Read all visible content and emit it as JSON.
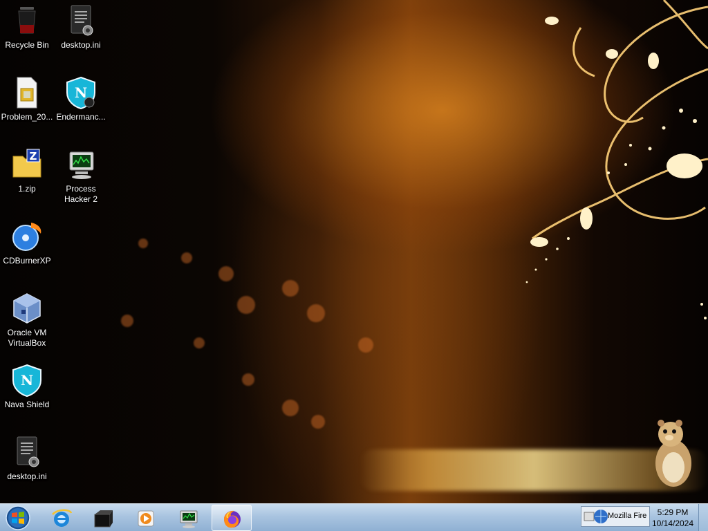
{
  "desktop": {
    "icons": [
      {
        "label": "Recycle Bin",
        "icon": "recycle-bin-icon"
      },
      {
        "label": "desktop.ini",
        "icon": "settings-file-icon"
      },
      {
        "label": "Problem_20...",
        "icon": "image-file-icon"
      },
      {
        "label": "Endermanc...",
        "icon": "shield-n-icon"
      },
      {
        "label": "1.zip",
        "icon": "zip-folder-icon"
      },
      {
        "label": "Process Hacker 2",
        "icon": "monitor-app-icon"
      },
      {
        "label": "CDBurnerXP",
        "icon": "cd-disc-icon"
      },
      {
        "label": "Oracle VM VirtualBox",
        "icon": "virtualbox-cube-icon"
      },
      {
        "label": "Nava Shield",
        "icon": "shield-n-icon"
      },
      {
        "label": "desktop.ini",
        "icon": "settings-file-icon"
      }
    ]
  },
  "taskbar": {
    "start": "windows-orb-icon",
    "pinned": [
      {
        "icon": "internet-explorer-icon"
      },
      {
        "icon": "explorer-dark-icon"
      },
      {
        "icon": "media-player-icon"
      },
      {
        "icon": "process-hacker-icon"
      },
      {
        "icon": "firefox-icon",
        "active": true
      }
    ],
    "tray_tip": "Mozilla Fire",
    "clock": {
      "time": "5:29 PM",
      "date": "10/14/2024"
    }
  },
  "colors": {
    "taskbar_top": "#c9dcee",
    "taskbar_bottom": "#8fb0d3",
    "wallpaper_glow": "#d6801e"
  }
}
